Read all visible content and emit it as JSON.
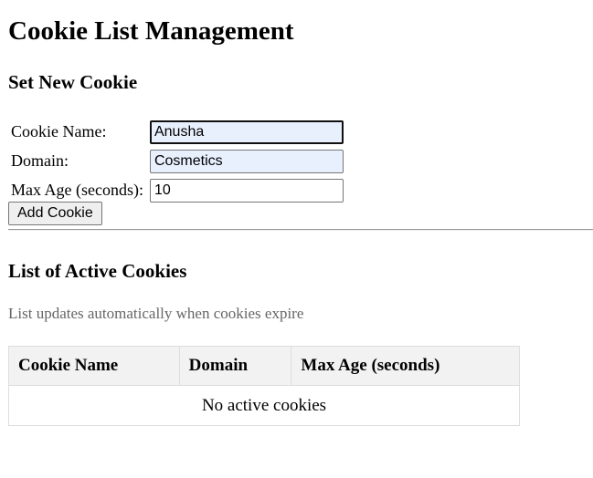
{
  "page": {
    "title": "Cookie List Management"
  },
  "set_cookie": {
    "heading": "Set New Cookie",
    "name_label": "Cookie Name:",
    "name_value": "Anusha",
    "domain_label": "Domain:",
    "domain_value": "Cosmetics",
    "max_age_label": "Max Age (seconds):",
    "max_age_value": "10",
    "add_button_label": "Add Cookie"
  },
  "active_cookies": {
    "heading": "List of Active Cookies",
    "note": "List updates automatically when cookies expire",
    "columns": [
      "Cookie Name",
      "Domain",
      "Max Age (seconds)"
    ],
    "empty_message": "No active cookies"
  },
  "colors": {
    "autofill_bg": "#e8f0fe",
    "header_bg": "#f2f2f2",
    "note_text": "#666666"
  }
}
